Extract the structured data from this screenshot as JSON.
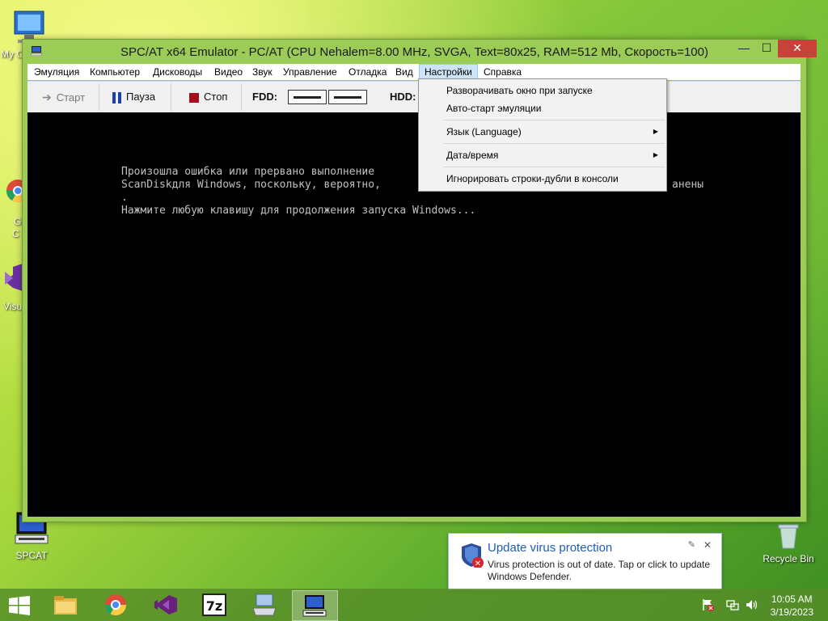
{
  "window": {
    "title": "SPC/AT x64 Emulator - PC/AT (CPU Nehalem=8.00 MHz, SVGA, Text=80x25, RAM=512 Mb, Скорость=100)",
    "min_label": "—",
    "max_label": "☐",
    "close_label": "✕"
  },
  "menubar": {
    "items": [
      "Эмуляция",
      "Компьютер",
      "Дисководы",
      "Видео",
      "Звук",
      "Управление",
      "Отладка",
      "Вид",
      "Настройки",
      "Справка"
    ],
    "active": "Настройки"
  },
  "toolbar": {
    "start_label": "Старт",
    "pause_label": "Пауза",
    "stop_label": "Стоп",
    "fdd_label": "FDD:",
    "hdd_label": "HDD:"
  },
  "console": {
    "lines": [
      "Произошла ошибка или прервано выполнение",
      "ScanDiskдля Windows, поскольку, вероятно,",
      ".",
      "Нажмите любую клавишу для продолжения запуска Windows..."
    ],
    "line2_tail": "анены"
  },
  "settings_menu": {
    "items": [
      {
        "label": "Разворачивать окно при запуске",
        "submenu": false
      },
      {
        "label": "Авто-старт эмуляции",
        "submenu": false
      },
      {
        "label": "Язык (Language)",
        "submenu": true
      },
      {
        "label": "Дата/время",
        "submenu": true
      },
      {
        "label": "Игнорировать строки-дубли в консоли",
        "submenu": false
      }
    ]
  },
  "desktop": {
    "icons": [
      {
        "label": "SPCAT"
      },
      {
        "label": "Recycle Bin"
      }
    ],
    "partial_labels": [
      "My C",
      "G",
      "C",
      "Visu"
    ]
  },
  "notification": {
    "title": "Update virus protection",
    "text": "Virus protection is out of date. Tap or click to update Windows Defender.",
    "close": "✕",
    "pin": "✎"
  },
  "taskbar": {
    "apps": [
      "file-explorer",
      "chrome",
      "visual-studio",
      "7zip",
      "spcat-pinned",
      "spcat-running"
    ],
    "time": "10:05 AM",
    "date": "3/19/2023"
  },
  "colors": {
    "accent_menu": "#cce4f7",
    "close_button": "#c7433a",
    "toast_title": "#1f5db8",
    "console_text": "#c0c0c0"
  }
}
